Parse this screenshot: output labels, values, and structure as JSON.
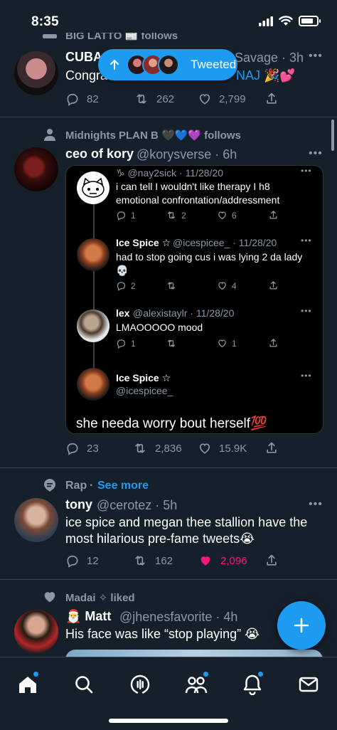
{
  "status_bar": {
    "time": "8:35"
  },
  "tweeted_pill": {
    "label": "Tweeted"
  },
  "tweet1": {
    "context": "BIG LATTO 📰 follows",
    "name_visible": "CUBA",
    "handle_tail": "Savage · 3h",
    "text_start": "Congra",
    "text_end": "NAJ 🎉💕",
    "replies": "82",
    "retweets": "262",
    "likes": "2,799"
  },
  "tweet2": {
    "context": "Midnights PLAN B 🖤💙💜 follows",
    "name": "ceo of kory",
    "handle": "@korysverse · 6h",
    "replies": "23",
    "retweets": "2,836",
    "likes": "15.9K",
    "quote": {
      "items": [
        {
          "name": "",
          "handle": "♑ @nay2sick · 11/28/20",
          "text": "i can tell I wouldn't like therapy I h8 emotional confrontation/addressment",
          "replies": "1",
          "retweets": "2",
          "likes": "6"
        },
        {
          "name": "Ice Spice ☆",
          "handle": "@icespicee_ · 11/28/20",
          "text": "had to stop going cus i was lying 2 da lady 💀",
          "replies": "2",
          "retweets": "",
          "likes": "4"
        },
        {
          "name": "lex",
          "handle": "@alexistaylr · 11/28/20",
          "text": "LMAOOOOO mood",
          "replies": "1",
          "retweets": "",
          "likes": "1"
        },
        {
          "name": "Ice Spice ☆",
          "handle": "@icespicee_",
          "text": "",
          "replies": "",
          "retweets": "",
          "likes": ""
        }
      ],
      "caption": "she needa worry bout herself💯"
    }
  },
  "tweet3": {
    "topic": "Rap",
    "see_more": "See more",
    "name": "tony",
    "handle": "@cerotez · 5h",
    "text": "ice spice and megan thee stallion have the most hilarious pre-fame tweets😭",
    "replies": "12",
    "retweets": "162",
    "likes": "2,096"
  },
  "tweet4": {
    "context": "Madai ✧ liked",
    "name": "🎅 Matt",
    "handle": "@jhenesfavorite · 4h",
    "text": "His face was like “stop playing” 😭"
  },
  "colors": {
    "background": "#15202b",
    "accent": "#1d9bf0",
    "muted": "#8b98a5",
    "like_active": "#f91880",
    "divider": "#38444d"
  },
  "icons": {
    "tabs": [
      "home-icon",
      "search-icon",
      "spaces-icon",
      "communities-icon",
      "notifications-icon",
      "messages-icon"
    ],
    "fab": "compose-icon"
  }
}
